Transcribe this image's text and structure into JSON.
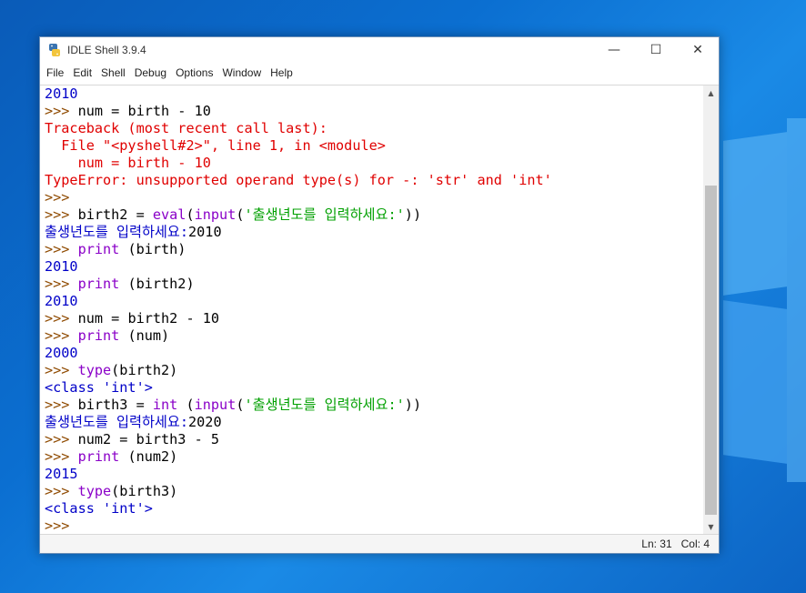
{
  "window": {
    "title": "IDLE Shell 3.9.4",
    "minimize": "—",
    "maximize": "☐",
    "close": "✕"
  },
  "menu": [
    "File",
    "Edit",
    "Shell",
    "Debug",
    "Options",
    "Window",
    "Help"
  ],
  "shell_lines": [
    [
      {
        "t": "2010",
        "c": "out"
      }
    ],
    [
      {
        "t": ">>> ",
        "c": "prompt"
      },
      {
        "t": "num = birth - 10",
        "c": "def"
      }
    ],
    [
      {
        "t": "Traceback (most recent call last):",
        "c": "err"
      }
    ],
    [
      {
        "t": "  File \"<pyshell#2>\", line 1, in <module>",
        "c": "err"
      }
    ],
    [
      {
        "t": "    num = birth - 10",
        "c": "err"
      }
    ],
    [
      {
        "t": "TypeError: unsupported operand type(s) for -: 'str' and 'int'",
        "c": "err"
      }
    ],
    [
      {
        "t": ">>>",
        "c": "prompt"
      }
    ],
    [
      {
        "t": ">>> ",
        "c": "prompt"
      },
      {
        "t": "birth2 = ",
        "c": "def"
      },
      {
        "t": "eval",
        "c": "kw"
      },
      {
        "t": "(",
        "c": "def"
      },
      {
        "t": "input",
        "c": "kw"
      },
      {
        "t": "(",
        "c": "def"
      },
      {
        "t": "'출생년도를 입력하세요:'",
        "c": "str"
      },
      {
        "t": "))",
        "c": "def"
      }
    ],
    [
      {
        "t": "출생년도를 입력하세요:",
        "c": "out"
      },
      {
        "t": "2010",
        "c": "def"
      }
    ],
    [
      {
        "t": ">>> ",
        "c": "prompt"
      },
      {
        "t": "print",
        "c": "kw"
      },
      {
        "t": " (birth)",
        "c": "def"
      }
    ],
    [
      {
        "t": "2010",
        "c": "out"
      }
    ],
    [
      {
        "t": ">>> ",
        "c": "prompt"
      },
      {
        "t": "print",
        "c": "kw"
      },
      {
        "t": " (birth2)",
        "c": "def"
      }
    ],
    [
      {
        "t": "2010",
        "c": "out"
      }
    ],
    [
      {
        "t": ">>> ",
        "c": "prompt"
      },
      {
        "t": "num = birth2 - 10",
        "c": "def"
      }
    ],
    [
      {
        "t": ">>> ",
        "c": "prompt"
      },
      {
        "t": "print",
        "c": "kw"
      },
      {
        "t": " (num)",
        "c": "def"
      }
    ],
    [
      {
        "t": "2000",
        "c": "out"
      }
    ],
    [
      {
        "t": ">>> ",
        "c": "prompt"
      },
      {
        "t": "type",
        "c": "kw"
      },
      {
        "t": "(birth2)",
        "c": "def"
      }
    ],
    [
      {
        "t": "<class 'int'>",
        "c": "out"
      }
    ],
    [
      {
        "t": ">>> ",
        "c": "prompt"
      },
      {
        "t": "birth3 = ",
        "c": "def"
      },
      {
        "t": "int",
        "c": "kw"
      },
      {
        "t": " (",
        "c": "def"
      },
      {
        "t": "input",
        "c": "kw"
      },
      {
        "t": "(",
        "c": "def"
      },
      {
        "t": "'출생년도를 입력하세요:'",
        "c": "str"
      },
      {
        "t": "))",
        "c": "def"
      }
    ],
    [
      {
        "t": "출생년도를 입력하세요:",
        "c": "out"
      },
      {
        "t": "2020",
        "c": "def"
      }
    ],
    [
      {
        "t": ">>> ",
        "c": "prompt"
      },
      {
        "t": "num2 = birth3 - 5",
        "c": "def"
      }
    ],
    [
      {
        "t": ">>> ",
        "c": "prompt"
      },
      {
        "t": "print",
        "c": "kw"
      },
      {
        "t": " (num2)",
        "c": "def"
      }
    ],
    [
      {
        "t": "2015",
        "c": "out"
      }
    ],
    [
      {
        "t": ">>> ",
        "c": "prompt"
      },
      {
        "t": "type",
        "c": "kw"
      },
      {
        "t": "(birth3)",
        "c": "def"
      }
    ],
    [
      {
        "t": "<class 'int'>",
        "c": "out"
      }
    ],
    [
      {
        "t": ">>>",
        "c": "prompt"
      }
    ]
  ],
  "status": {
    "ln": "Ln: 31",
    "col": "Col: 4"
  }
}
